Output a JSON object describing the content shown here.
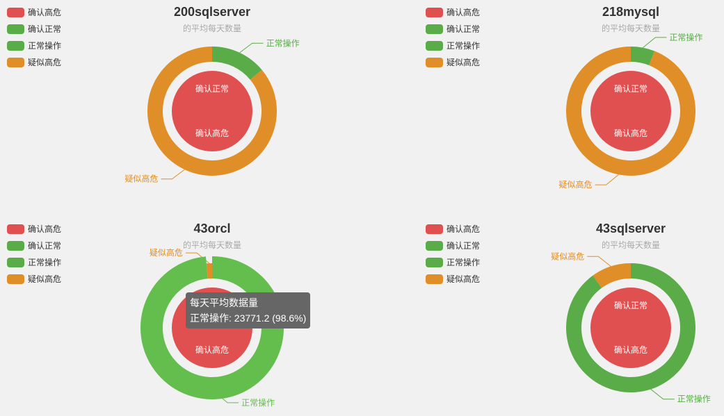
{
  "chart_data": [
    {
      "type": "pie",
      "title": "200sqlserver",
      "subtitle": "的平均每天数量",
      "legend": {
        "position": "top-left",
        "items": [
          {
            "name": "确认高危",
            "color": "#e05050"
          },
          {
            "name": "确认正常",
            "color": "#5aac48"
          },
          {
            "name": "正常操作",
            "color": "#5aac48"
          },
          {
            "name": "疑似高危",
            "color": "#e08f28"
          }
        ]
      },
      "rings": {
        "inner": [
          {
            "name": "确认高危",
            "value": 100,
            "color": "#e05050"
          },
          {
            "name": "确认正常",
            "value": 0,
            "color": "#5aac48"
          }
        ],
        "outer": [
          {
            "name": "正常操作",
            "value": 14,
            "color": "#5aac48"
          },
          {
            "name": "疑似高危",
            "value": 86,
            "color": "#e08f28"
          }
        ]
      }
    },
    {
      "type": "pie",
      "title": "218mysql",
      "subtitle": "的平均每天数量",
      "legend": {
        "position": "top-left",
        "items": [
          {
            "name": "确认高危",
            "color": "#e05050"
          },
          {
            "name": "确认正常",
            "color": "#5aac48"
          },
          {
            "name": "正常操作",
            "color": "#5aac48"
          },
          {
            "name": "疑似高危",
            "color": "#e08f28"
          }
        ]
      },
      "rings": {
        "inner": [
          {
            "name": "确认高危",
            "value": 100,
            "color": "#e05050"
          },
          {
            "name": "确认正常",
            "value": 0,
            "color": "#5aac48"
          }
        ],
        "outer": [
          {
            "name": "正常操作",
            "value": 6,
            "color": "#5aac48"
          },
          {
            "name": "疑似高危",
            "value": 94,
            "color": "#e08f28"
          }
        ]
      }
    },
    {
      "type": "pie",
      "title": "43orcl",
      "subtitle": "的平均每天数量",
      "legend": {
        "position": "top-left",
        "items": [
          {
            "name": "确认高危",
            "color": "#e05050"
          },
          {
            "name": "确认正常",
            "color": "#5aac48"
          },
          {
            "name": "正常操作",
            "color": "#5aac48"
          },
          {
            "name": "疑似高危",
            "color": "#e08f28"
          }
        ]
      },
      "rings": {
        "inner": [
          {
            "name": "确认高危",
            "value": 100,
            "color": "#e05050"
          },
          {
            "name": "确认正常",
            "value": 0,
            "color": "#5aac48"
          }
        ],
        "outer": [
          {
            "name": "正常操作",
            "value": 98.6,
            "color": "#64be4e",
            "hovered": true
          },
          {
            "name": "疑似高危",
            "value": 1.4,
            "color": "#e08f28"
          }
        ]
      },
      "tooltip": {
        "title": "每天平均数据量",
        "text": "正常操作: 23771.2 (98.6%)"
      }
    },
    {
      "type": "pie",
      "title": "43sqlserver",
      "subtitle": "的平均每天数量",
      "legend": {
        "position": "top-left",
        "items": [
          {
            "name": "确认高危",
            "color": "#e05050"
          },
          {
            "name": "确认正常",
            "color": "#5aac48"
          },
          {
            "name": "正常操作",
            "color": "#5aac48"
          },
          {
            "name": "疑似高危",
            "color": "#e08f28"
          }
        ]
      },
      "rings": {
        "inner": [
          {
            "name": "确认高危",
            "value": 100,
            "color": "#e05050"
          },
          {
            "name": "确认正常",
            "value": 0,
            "color": "#5aac48"
          }
        ],
        "outer": [
          {
            "name": "正常操作",
            "value": 90,
            "color": "#5aac48"
          },
          {
            "name": "疑似高危",
            "value": 10,
            "color": "#e08f28"
          }
        ]
      }
    }
  ]
}
